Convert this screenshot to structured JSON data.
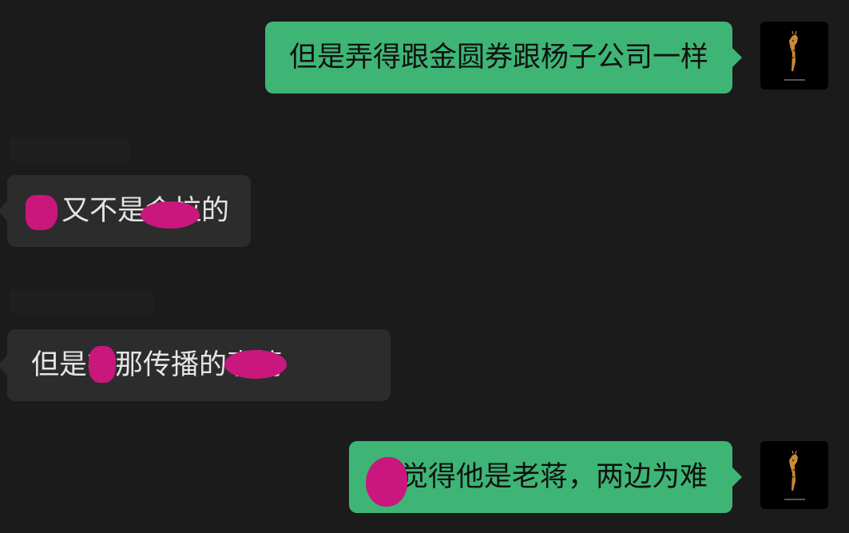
{
  "messages": [
    {
      "id": "m1",
      "side": "out",
      "text": "但是弄得跟金圆券跟杨子公司一样"
    },
    {
      "id": "m2",
      "side": "in",
      "text": "又不是会拉的"
    },
    {
      "id": "m3",
      "side": "in",
      "text": "但是在那传播的事情"
    },
    {
      "id": "m4",
      "side": "out",
      "text": "觉得他是老蒋，两边为难"
    }
  ],
  "colors": {
    "background": "#1b1b1b",
    "outgoing_bubble": "#3eb575",
    "incoming_bubble": "#2c2c2c",
    "redaction": "#c9177e"
  },
  "avatar": {
    "icon": "giraffe-avatar-icon"
  }
}
